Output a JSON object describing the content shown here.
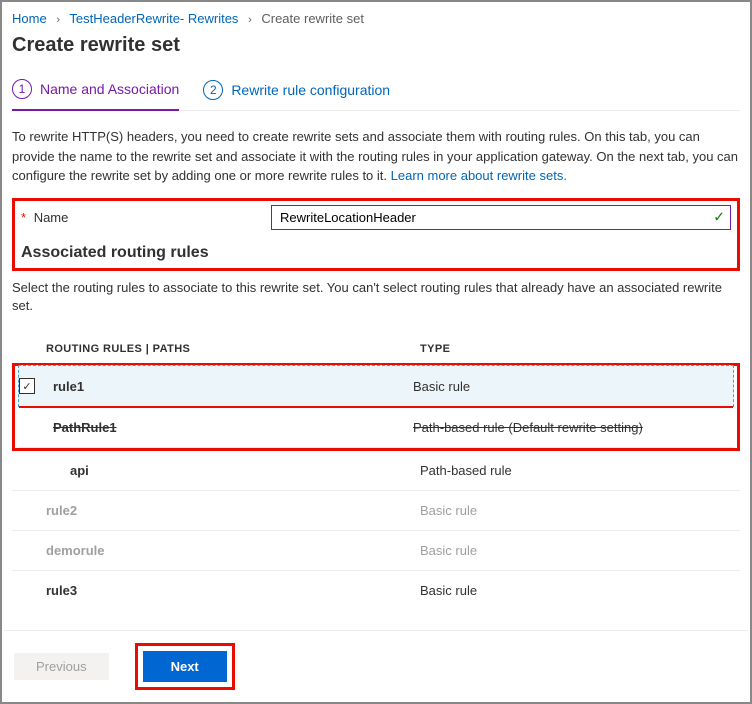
{
  "breadcrumb": {
    "home": "Home",
    "parent": "TestHeaderRewrite- Rewrites",
    "current": "Create rewrite set"
  },
  "page_title": "Create rewrite set",
  "tabs": {
    "t1_num": "1",
    "t1_label": "Name and Association",
    "t2_num": "2",
    "t2_label": "Rewrite rule configuration"
  },
  "description": "To rewrite HTTP(S) headers, you need to create rewrite sets and associate them with routing rules. On this tab, you can provide the name to the rewrite set and associate it with the routing rules in your application gateway. On the next tab, you can configure the rewrite set by adding one or more rewrite rules to it.  ",
  "learn_more": "Learn more about rewrite sets.",
  "name_label": "Name",
  "name_value": "RewriteLocationHeader",
  "assoc_heading": "Associated routing rules",
  "assoc_subdesc": "Select the routing rules to associate to this rewrite set. You can't select routing rules that already have an associated rewrite set.",
  "headers": {
    "rules": "ROUTING RULES | PATHS",
    "type": "TYPE"
  },
  "rows": {
    "r0": {
      "name": "rule1",
      "type": "Basic rule",
      "checked": "✓"
    },
    "r1": {
      "name": "PathRule1",
      "type": "Path-based rule (Default rewrite setting)"
    },
    "r2": {
      "name": "api",
      "type": "Path-based rule"
    },
    "r3": {
      "name": "rule2",
      "type": "Basic rule"
    },
    "r4": {
      "name": "demorule",
      "type": "Basic rule"
    },
    "r5": {
      "name": "rule3",
      "type": "Basic rule"
    }
  },
  "footer": {
    "prev": "Previous",
    "next": "Next"
  }
}
